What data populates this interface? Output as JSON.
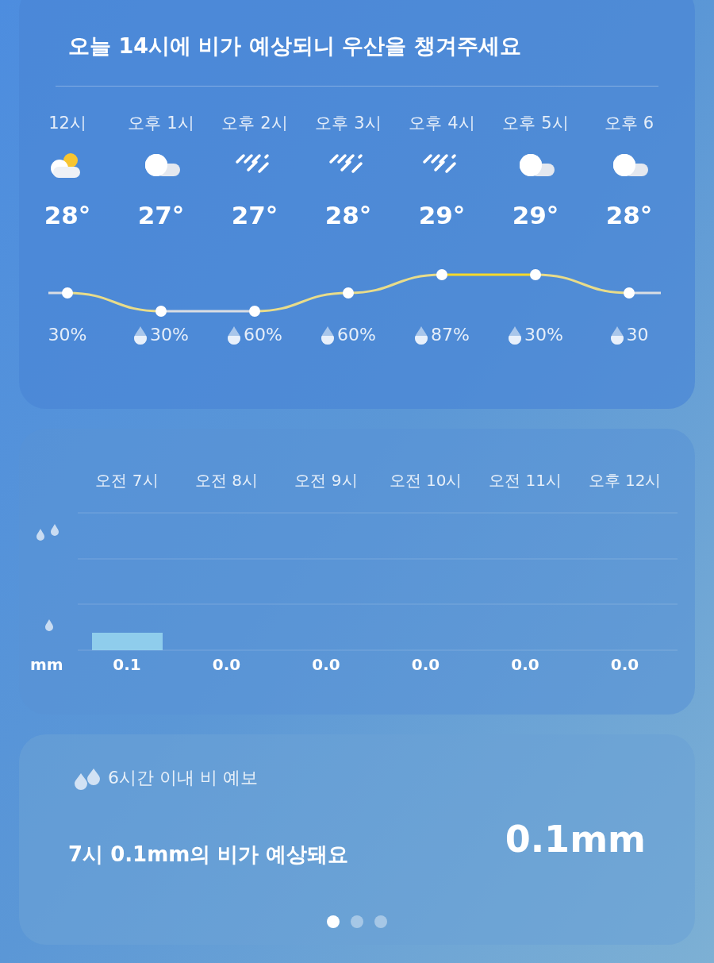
{
  "alert": "오늘 14시에 비가 예상되니 우산을 챙겨주세요",
  "hourly": [
    {
      "time": "12시",
      "kind": "partly_sunny",
      "temp": "28°",
      "pop": "30%"
    },
    {
      "time": "오후 1시",
      "kind": "cloudy",
      "temp": "27°",
      "pop": "30%"
    },
    {
      "time": "오후 2시",
      "kind": "rain",
      "temp": "27°",
      "pop": "60%"
    },
    {
      "time": "오후 3시",
      "kind": "rain",
      "temp": "28°",
      "pop": "60%"
    },
    {
      "time": "오후 4시",
      "kind": "rain",
      "temp": "29°",
      "pop": "87%"
    },
    {
      "time": "오후 5시",
      "kind": "cloudy",
      "temp": "29°",
      "pop": "30%"
    },
    {
      "time": "오후 6",
      "kind": "cloudy",
      "temp": "28°",
      "pop": "30"
    }
  ],
  "precipitation": {
    "unit": "mm",
    "hours": [
      {
        "time": "오전 7시",
        "amount": "0.1"
      },
      {
        "time": "오전 8시",
        "amount": "0.0"
      },
      {
        "time": "오전 9시",
        "amount": "0.0"
      },
      {
        "time": "오전 10시",
        "amount": "0.0"
      },
      {
        "time": "오전 11시",
        "amount": "0.0"
      },
      {
        "time": "오후 12시",
        "amount": "0.0"
      }
    ]
  },
  "forecast": {
    "title": "6시간 이내 비 예보",
    "message": "7시 0.1mm의 비가 예상돼요",
    "amount": "0.1mm"
  },
  "pages": [
    {
      "selected": true
    },
    {
      "selected": false
    },
    {
      "selected": false
    }
  ]
}
